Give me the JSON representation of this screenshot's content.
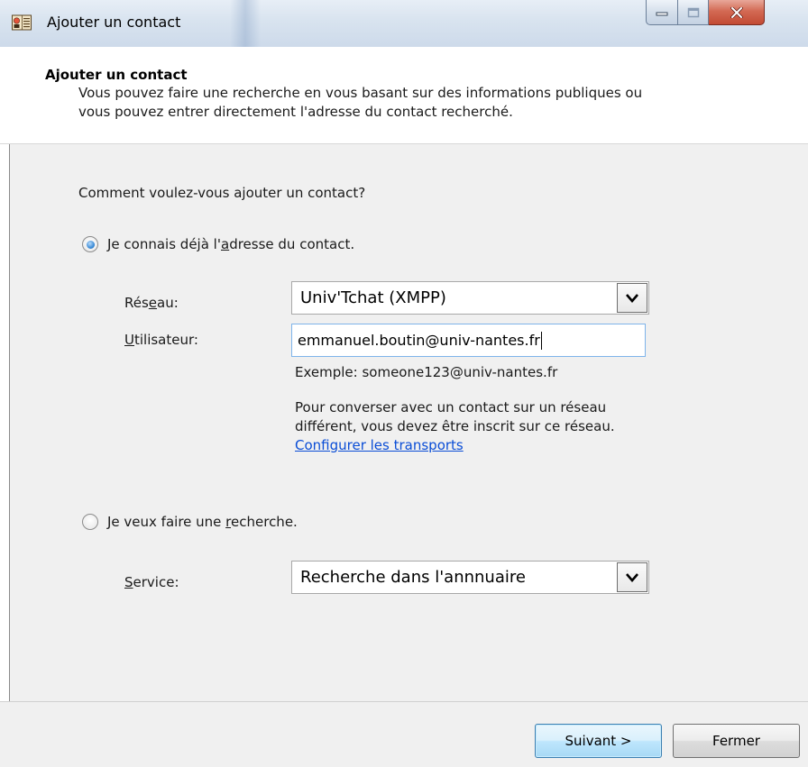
{
  "window": {
    "title": "Ajouter un contact",
    "app_icon": "contact-book-icon",
    "controls": [
      "minimize-icon",
      "maximize-icon",
      "close-icon"
    ]
  },
  "header": {
    "title": "Ajouter un contact",
    "desc_line1": "Vous pouvez faire une recherche en vous basant sur des informations publiques ou",
    "desc_line2": "vous pouvez entrer directement l'adresse du contact recherché."
  },
  "form": {
    "question": "Comment voulez-vous ajouter un contact?",
    "option_address": {
      "label_pre": "Je connais déjà l'",
      "label_mnemonic": "a",
      "label_post": "dresse du contact.",
      "selected": true
    },
    "network": {
      "label_pre": "Rés",
      "label_mnemonic": "e",
      "label_post": "au:",
      "value": "Univ'Tchat (XMPP)"
    },
    "user": {
      "label_mnemonic": "U",
      "label_post": "tilisateur:",
      "value": "emmanuel.boutin@univ-nantes.fr"
    },
    "example": "Exemple: someone123@univ-nantes.fr",
    "note_line1": "Pour converser avec un contact sur un réseau",
    "note_line2": "différent, vous devez être inscrit sur ce réseau.",
    "configure_link": "Configurer les transports",
    "option_search": {
      "label_pre": "Je veux faire une ",
      "label_mnemonic": "r",
      "label_post": "echerche.",
      "selected": false
    },
    "service": {
      "label_mnemonic": "S",
      "label_post": "ervice:",
      "value": "Recherche dans l'annnuaire"
    }
  },
  "buttons": {
    "next": "Suivant >",
    "close": "Fermer"
  },
  "colors": {
    "link": "#0a4dd6",
    "radio_selected": "#2a7fd0",
    "close_button": "#c24a33"
  }
}
